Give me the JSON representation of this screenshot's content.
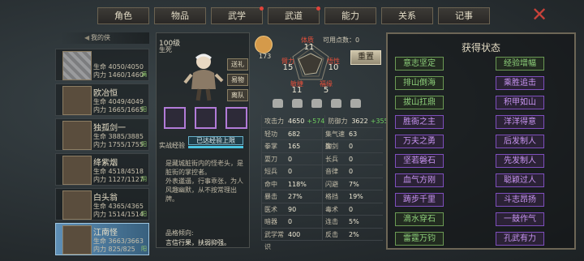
{
  "tabs": [
    {
      "label": "角色",
      "active": true,
      "dot": false
    },
    {
      "label": "物品",
      "active": false,
      "dot": false
    },
    {
      "label": "武学",
      "active": false,
      "dot": true
    },
    {
      "label": "武道",
      "active": false,
      "dot": true
    },
    {
      "label": "能力",
      "active": false,
      "dot": false
    },
    {
      "label": "关系",
      "active": false,
      "dot": false
    },
    {
      "label": "记事",
      "active": false,
      "dot": false
    }
  ],
  "list_header": "我的侠",
  "heroes": [
    {
      "name": "",
      "hp": "生命 4050/4050",
      "mp": "内力 1460/1460",
      "tag": "满",
      "blur": true
    },
    {
      "name": "欧冶恒",
      "hp": "生命 4049/4049",
      "mp": "内力 1665/1665",
      "tag": "阳",
      "blur": false
    },
    {
      "name": "独孤剑一",
      "hp": "生命 3885/3885",
      "mp": "内力 1755/1755",
      "tag": "阳",
      "blur": false
    },
    {
      "name": "绛紫烟",
      "hp": "生命 4518/4518",
      "mp": "内力 1127/1127",
      "tag": "阴",
      "blur": false
    },
    {
      "name": "白头翁",
      "hp": "生命 4365/4365",
      "mp": "内力 1514/1514",
      "tag": "阳",
      "blur": false
    },
    {
      "name": "江南怪",
      "hp": "生命 3663/3663",
      "mp": "内力 825/825",
      "tag": "阳",
      "blur": false,
      "selected": true
    }
  ],
  "character": {
    "level": "100级",
    "state": "生死",
    "buttons": [
      "送礼",
      "易物",
      "离队"
    ],
    "exp_label": "实战经验",
    "exp_bar": "已达经验上限",
    "exp_fill": 1.0,
    "bio": [
      "是藏城脏街内的怪老头，是脏街的掌控者。",
      "外表邋遢，行事乖张，为人风趣幽默，从不按常理出牌。"
    ],
    "personality_label": "品格倾向:",
    "personality": "言信行果，扶弱抑强。"
  },
  "points": {
    "label": "可用点数：",
    "value": "0"
  },
  "reset_label": "重置",
  "penmanship": "173",
  "attributes": {
    "tizhi": {
      "label": "体质",
      "value": "11"
    },
    "biili": {
      "label": "臂力",
      "value": "15"
    },
    "wuxing": {
      "label": "悟性",
      "value": "10"
    },
    "minjie": {
      "label": "敏捷",
      "value": "11"
    },
    "fuyuan": {
      "label": "福缘",
      "value": "5"
    }
  },
  "stats": [
    [
      {
        "k": "攻击力",
        "v": "4650",
        "g": "+574"
      },
      {
        "k": "防御力",
        "v": "3622",
        "g": "+355"
      }
    ],
    [
      {
        "k": "轻功",
        "v": "682",
        "g": ""
      },
      {
        "k": "集气速度",
        "v": "63",
        "g": ""
      }
    ],
    [
      {
        "k": "拳掌",
        "v": "165",
        "g": ""
      },
      {
        "k": "御剑",
        "v": "0",
        "g": ""
      }
    ],
    [
      {
        "k": "耍刀",
        "v": "0",
        "g": ""
      },
      {
        "k": "长兵",
        "v": "0",
        "g": ""
      }
    ],
    [
      {
        "k": "短兵",
        "v": "0",
        "g": ""
      },
      {
        "k": "音律",
        "v": "0",
        "g": ""
      }
    ],
    [
      {
        "k": "命中",
        "v": "118%",
        "g": ""
      },
      {
        "k": "闪避",
        "v": "7%",
        "g": ""
      }
    ],
    [
      {
        "k": "暴击",
        "v": "27%",
        "g": ""
      },
      {
        "k": "格挡",
        "v": "19%",
        "g": ""
      }
    ],
    [
      {
        "k": "医术",
        "v": "90",
        "g": ""
      },
      {
        "k": "毒术",
        "v": "0",
        "g": ""
      }
    ],
    [
      {
        "k": "暗器",
        "v": "0",
        "g": ""
      },
      {
        "k": "连击",
        "v": "5%",
        "g": ""
      }
    ],
    [
      {
        "k": "武学常识",
        "v": "400",
        "g": ""
      },
      {
        "k": "反击",
        "v": "2%",
        "g": ""
      }
    ]
  ],
  "status_title": "获得状态",
  "statuses": [
    {
      "label": "意志坚定",
      "color": "teal"
    },
    {
      "label": "经验增幅",
      "color": "teal"
    },
    {
      "label": "排山倒海",
      "color": "teal"
    },
    {
      "label": "乘胜追击",
      "color": "purple"
    },
    {
      "label": "拔山扛鼎",
      "color": "teal"
    },
    {
      "label": "积甲如山",
      "color": "purple"
    },
    {
      "label": "胜衙之主",
      "color": "purple"
    },
    {
      "label": "洋洋得意",
      "color": "purple"
    },
    {
      "label": "万夫之勇",
      "color": "purple"
    },
    {
      "label": "后发制人",
      "color": "purple"
    },
    {
      "label": "坚若磐石",
      "color": "purple"
    },
    {
      "label": "先发制人",
      "color": "purple"
    },
    {
      "label": "血气方刚",
      "color": "purple"
    },
    {
      "label": "聪颖过人",
      "color": "purple"
    },
    {
      "label": "踌步千里",
      "color": "purple"
    },
    {
      "label": "斗志昂扬",
      "color": "purple"
    },
    {
      "label": "滴水穿石",
      "color": "green"
    },
    {
      "label": "一鼓作气",
      "color": "purple"
    },
    {
      "label": "雷霆万钧",
      "color": "green"
    },
    {
      "label": "孔武有力",
      "color": "purple"
    }
  ]
}
